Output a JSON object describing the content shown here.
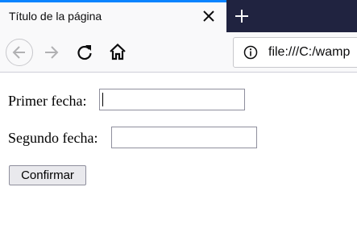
{
  "browser": {
    "tab_title": "Título de la página",
    "url": "file:///C:/wamp",
    "icons": {
      "close": "close-icon",
      "new_tab": "plus-icon",
      "back": "arrow-left-icon",
      "forward": "arrow-right-icon",
      "reload": "reload-icon",
      "home": "home-icon",
      "site_info": "info-icon"
    },
    "colors": {
      "tabstrip": "#202340",
      "tab_accent": "#0a84ff",
      "toolbar": "#f9f9fa"
    }
  },
  "form": {
    "first_date_label": "Primer fecha:",
    "first_date_value": "",
    "second_date_label": "Segundo fecha:",
    "second_date_value": "",
    "submit_label": "Confirmar"
  }
}
